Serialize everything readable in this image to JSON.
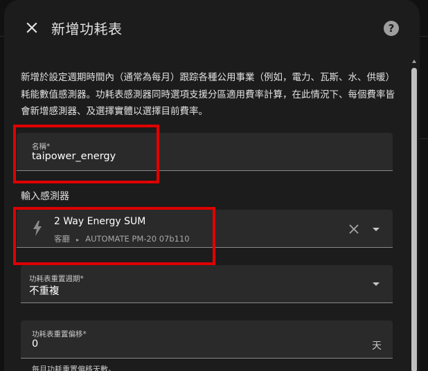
{
  "dialog": {
    "title": "新增功耗表",
    "description": "新增於設定週期時間內（通常為每月）跟踪各種公用事業（例如，電力、瓦斯、水、供暖）耗能數值感測器。功耗表感測器同時選項支援分區適用費率計算，在此情況下、每個費率皆會新增感測器、及選擇實體以選擇目前費率。"
  },
  "name_field": {
    "label": "名稱*",
    "value": "taipower_energy"
  },
  "input_sensor": {
    "section_label": "輸入感測器",
    "entity_name": "2 Way Energy SUM",
    "area": "客廳",
    "device": "AUTOMATE PM-20 07b110",
    "icon": "flash-icon"
  },
  "reset_cycle": {
    "label": "功耗表重置週期*",
    "value": "不重複"
  },
  "reset_offset": {
    "label": "功耗表重置偏移*",
    "value": "0",
    "unit": "天"
  },
  "helper_text": "每月功耗重置偏移天數。",
  "colors": {
    "highlight": "#e00000",
    "dialog_bg": "#1c1c1c",
    "field_bg": "#2a2a2a"
  }
}
